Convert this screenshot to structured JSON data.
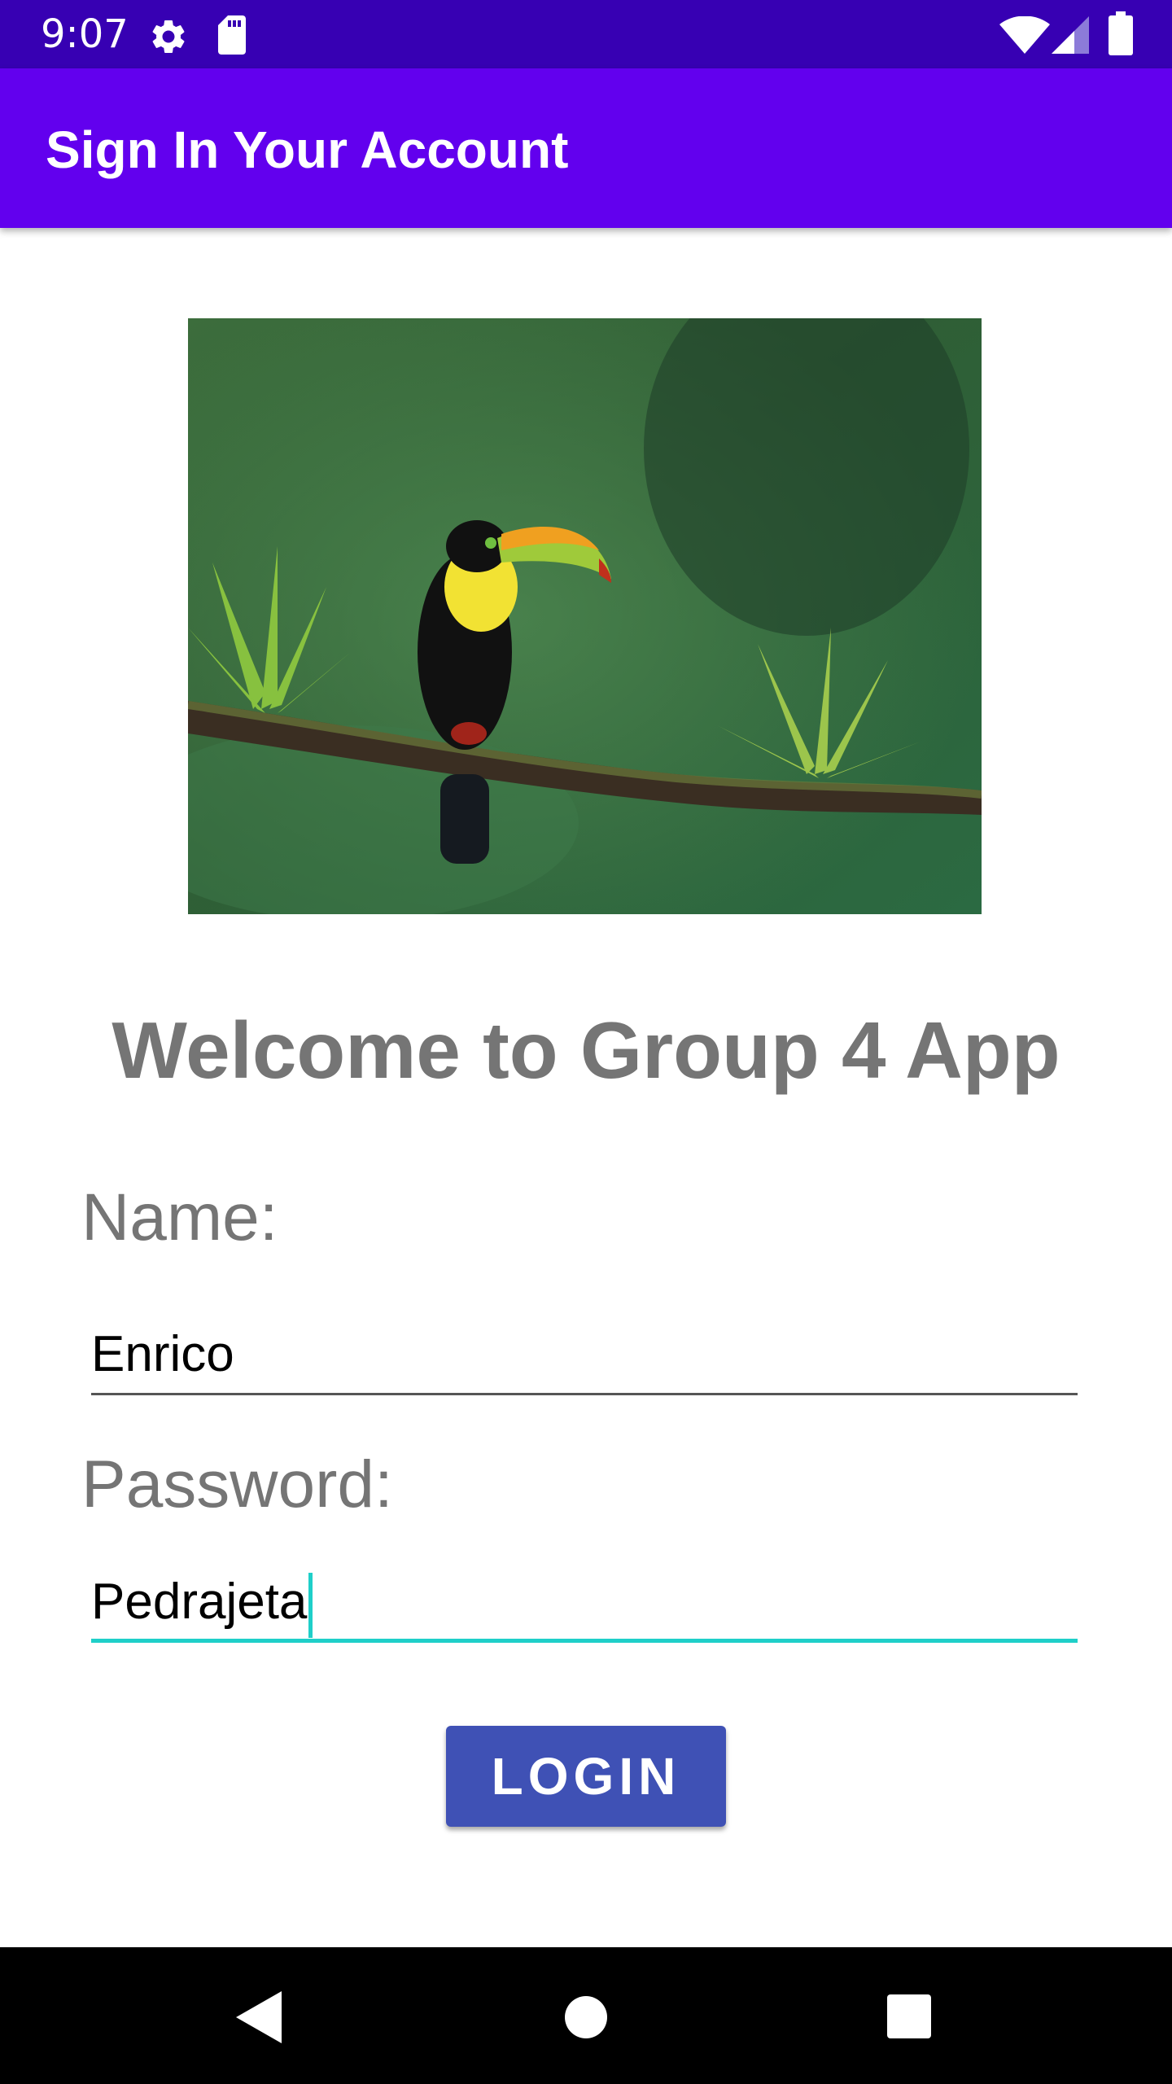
{
  "status_bar": {
    "time": "9:07",
    "icons": [
      "gear-icon",
      "sd-card-icon",
      "wifi-icon",
      "signal-icon",
      "battery-icon"
    ]
  },
  "app_bar": {
    "title": "Sign In Your Account",
    "color": "#6200EE"
  },
  "hero_image": {
    "description_icon": "toucan-photo"
  },
  "welcome_text": "Welcome to Group 4 App",
  "form": {
    "name_label": "Name:",
    "name_value": "Enrico",
    "password_label": "Password:",
    "password_value": "Pedrajeta",
    "accent_color": "#1FCFC9"
  },
  "login_button": {
    "label": "LOGIN",
    "color": "#3F51B5"
  },
  "nav_bar": {
    "icons": [
      "back-icon",
      "home-icon",
      "recents-icon"
    ]
  }
}
